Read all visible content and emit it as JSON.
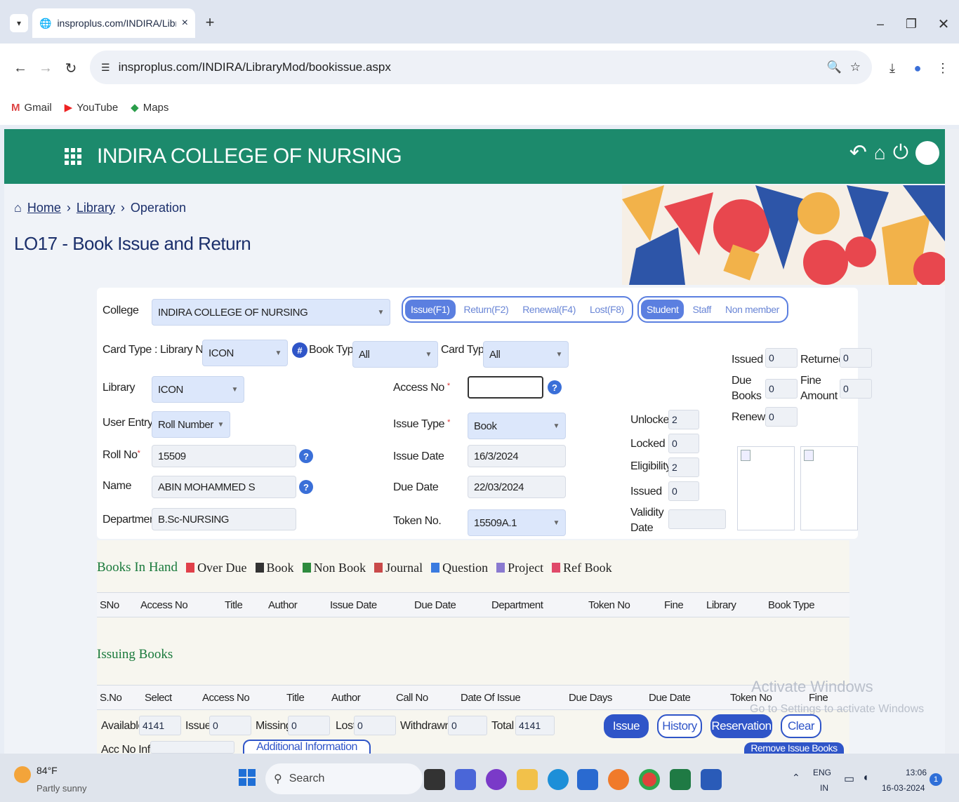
{
  "browser": {
    "tab_title": "insproplus.com/INDIRA/Library",
    "new_tab": "+",
    "url": "insproplus.com/INDIRA/LibraryMod/bookissue.aspx",
    "bookmarks": [
      "Gmail",
      "YouTube",
      "Maps"
    ]
  },
  "app": {
    "title": "INDIRA COLLEGE OF NURSING",
    "breadcrumb": {
      "home": "Home",
      "library": "Library",
      "current": "Operation"
    },
    "page_title": "LO17 - Book Issue and Return"
  },
  "form": {
    "college_label": "College",
    "college_value": "INDIRA COLLEGE OF NURSING",
    "mode_tabs": [
      "Issue(F1)",
      "Return(F2)",
      "Renewal(F4)",
      "Lost(F8)"
    ],
    "member_tabs": [
      "Student",
      "Staff",
      "Non member"
    ],
    "card_type_library_label": "Card Type : Library Name",
    "card_type_library_value": "ICON",
    "hash_badge": "#",
    "book_type_label": "Book Type",
    "book_type_value": "All",
    "card_type_label": "Card Type",
    "card_type_value": "All",
    "library_label": "Library",
    "library_value": "ICON",
    "access_no_label": "Access No",
    "access_no_value": "",
    "user_entry_label": "User Entry",
    "user_entry_value": "Roll Number",
    "issue_type_label": "Issue Type",
    "issue_type_value": "Book",
    "roll_no_label": "Roll No",
    "roll_no_value": "15509",
    "issue_date_label": "Issue Date",
    "issue_date_value": "16/3/2024",
    "name_label": "Name",
    "name_value": "ABIN MOHAMMED S",
    "due_date_label": "Due Date",
    "due_date_value": "22/03/2024",
    "department_label": "Department",
    "department_value": "B.Sc-NURSING",
    "token_no_label": "Token No.",
    "token_no_value": "15509A.1",
    "required_mark": "*",
    "help_mark": "?"
  },
  "stats": {
    "unlocked_label": "Unlocked",
    "unlocked_value": "2",
    "locked_label": "Locked",
    "locked_value": "0",
    "eligibility_label": "Eligibility",
    "eligibility_value": "2",
    "issued_label": "Issued",
    "issued_value": "0",
    "validity_label": "Validity Date",
    "validity_value": "",
    "issued2_label": "Issued",
    "issued2_value": "0",
    "returned_label": "Returned",
    "returned_value": "0",
    "due_books_label": "Due Books",
    "due_books_value": "0",
    "fine_label": "Fine Amount",
    "fine_value": "0",
    "renewal_label": "Renewal",
    "renewal_value": "0"
  },
  "legend": {
    "books_in_hand": "Books In Hand",
    "items": [
      {
        "label": "Over Due",
        "color": "#e0404a"
      },
      {
        "label": "Book",
        "color": "#333333"
      },
      {
        "label": "Non Book",
        "color": "#2e8b3e"
      },
      {
        "label": "Journal",
        "color": "#c94a4a"
      },
      {
        "label": "Question",
        "color": "#3a7be0"
      },
      {
        "label": "Project",
        "color": "#8a7ad0"
      },
      {
        "label": "Ref Book",
        "color": "#e04a6a"
      }
    ]
  },
  "books_table_headers": [
    "SNo",
    "Access No",
    "Title",
    "Author",
    "Issue Date",
    "Due Date",
    "Department",
    "Token No",
    "Fine",
    "Library",
    "Book Type"
  ],
  "issuing": {
    "title": "Issuing Books",
    "headers": [
      "S.No",
      "Select",
      "Access No",
      "Title",
      "Author",
      "Call No",
      "Date Of Issue",
      "Due Days",
      "Due Date",
      "Token No",
      "Fine"
    ]
  },
  "summary": {
    "available_label": "Available",
    "available_value": "4141",
    "issue_label": "Issue",
    "issue_value": "0",
    "missing_label": "Missing",
    "missing_value": "0",
    "lost_label": "Lost",
    "lost_value": "0",
    "withdrawn_label": "Withdrawn",
    "withdrawn_value": "0",
    "total_label": "Total",
    "total_value": "4141",
    "acc_no_info_label": "Acc No Info",
    "additional_info": "Additional Information",
    "remove_issue_books": "Remove Issue Books"
  },
  "actions": {
    "issue": "Issue",
    "history": "History",
    "reservation": "Reservation",
    "clear": "Clear"
  },
  "watermark": {
    "line1": "Activate Windows",
    "line2": "Go to Settings to activate Windows"
  },
  "taskbar": {
    "weather_temp": "84°F",
    "weather_desc": "Partly sunny",
    "search": "Search",
    "lang1": "ENG",
    "lang2": "IN",
    "time": "13:06",
    "date": "16-03-2024",
    "notif_count": "1"
  },
  "colors": {
    "header": "#1c8a6c",
    "accent": "#2f55c8"
  }
}
